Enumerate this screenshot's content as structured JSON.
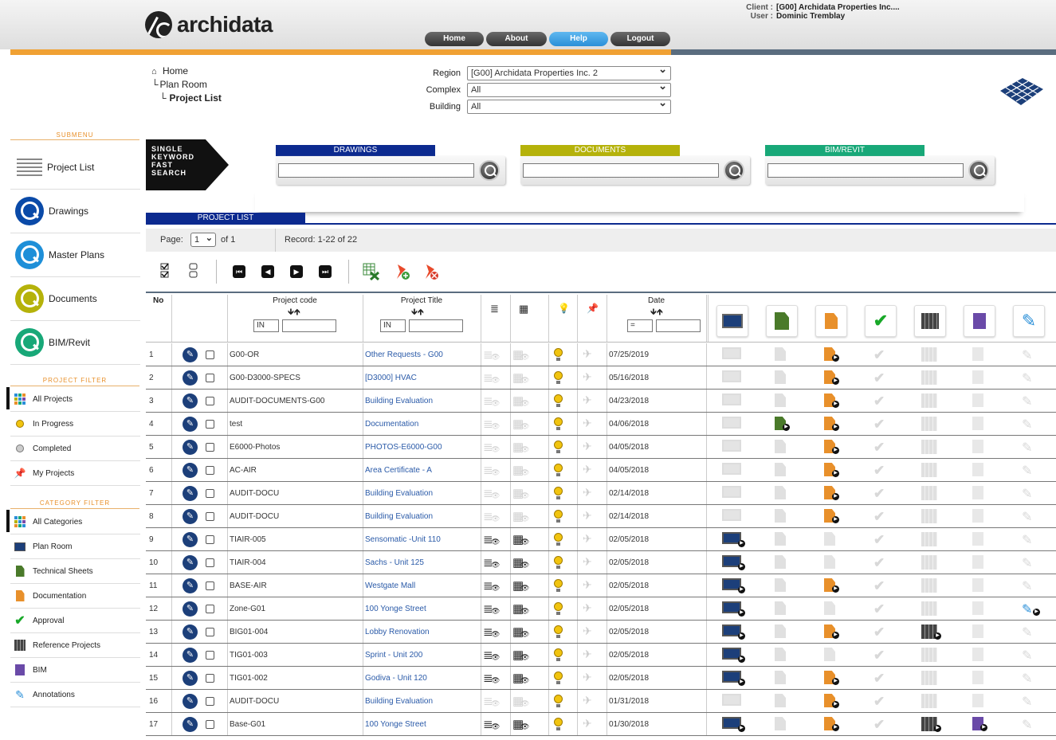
{
  "header": {
    "logo_text": "archidata",
    "client_label": "Client :",
    "client_value": "[G00] Archidata Properties Inc....",
    "user_label": "User :",
    "user_value": "Dominic Tremblay",
    "nav": [
      "Home",
      "About",
      "Help",
      "Logout"
    ]
  },
  "breadcrumb": [
    "Home",
    "Plan Room",
    "Project List"
  ],
  "filters": {
    "region_label": "Region",
    "region_value": "[G00] Archidata Properties Inc. 2",
    "complex_label": "Complex",
    "complex_value": "All",
    "building_label": "Building",
    "building_value": "All"
  },
  "sidebar": {
    "submenu_title": "SUBMENU",
    "main_items": [
      {
        "label": "Project List",
        "icon": "list-icon"
      },
      {
        "label": "Drawings",
        "icon": "search-blue-icon",
        "color": "#0a4aa8"
      },
      {
        "label": "Master Plans",
        "icon": "search-lightblue-icon",
        "color": "#1e8fd8"
      },
      {
        "label": "Documents",
        "icon": "search-olive-icon",
        "color": "#b5b20a"
      },
      {
        "label": "BIM/Revit",
        "icon": "search-green-icon",
        "color": "#18a878"
      }
    ],
    "project_filter_title": "PROJECT FILTER",
    "project_filters": [
      {
        "label": "All Projects",
        "icon": "grid-icon"
      },
      {
        "label": "In Progress",
        "icon": "bulb-icon"
      },
      {
        "label": "Completed",
        "icon": "bulb-off-icon"
      },
      {
        "label": "My Projects",
        "icon": "pin-icon"
      }
    ],
    "category_filter_title": "CATEGORY FILTER",
    "category_filters": [
      {
        "label": "All Categories",
        "icon": "grid-icon"
      },
      {
        "label": "Plan Room",
        "icon": "screen-icon"
      },
      {
        "label": "Technical Sheets",
        "icon": "sheets-icon"
      },
      {
        "label": "Documentation",
        "icon": "doc-icon"
      },
      {
        "label": "Approval",
        "icon": "check-icon"
      },
      {
        "label": "Reference Projects",
        "icon": "binder-icon"
      },
      {
        "label": "BIM",
        "icon": "bim-icon"
      },
      {
        "label": "Annotations",
        "icon": "pencil-icon"
      }
    ]
  },
  "search": {
    "single_text": [
      "SINGLE",
      "KEYWORD",
      "FAST",
      "SEARCH"
    ],
    "drawings_label": "DRAWINGS",
    "documents_label": "DOCUMENTS",
    "bim_label": "BIM/REVIT",
    "colors": {
      "drawings": "#0c2a8f",
      "documents": "#b5b20a",
      "bim": "#18a878"
    }
  },
  "project_list": {
    "title": "PROJECT LIST",
    "page_label": "Page:",
    "page_value": "1",
    "page_of": "of 1",
    "record_label": "Record: 1-22 of 22"
  },
  "table": {
    "col_no": "No",
    "col_code": "Project code",
    "col_title": "Project Title",
    "col_date": "Date",
    "op_in": "IN",
    "op_eq": "=",
    "rows": [
      {
        "no": "1",
        "code": "G00-OR",
        "title": "Other Requests - G00",
        "date": "07/25/2019",
        "drw": false,
        "master": false,
        "tech": false,
        "doc": true,
        "ref": false,
        "bim": false,
        "ann": false
      },
      {
        "no": "2",
        "code": "G00-D3000-SPECS",
        "title": "[D3000] HVAC",
        "date": "05/16/2018",
        "drw": false,
        "master": false,
        "tech": false,
        "doc": true,
        "ref": false,
        "bim": false,
        "ann": false
      },
      {
        "no": "3",
        "code": "AUDIT-DOCUMENTS-G00",
        "title": "Building Evaluation",
        "date": "04/23/2018",
        "drw": false,
        "master": false,
        "tech": false,
        "doc": true,
        "ref": false,
        "bim": false,
        "ann": false
      },
      {
        "no": "4",
        "code": "test",
        "title": "Documentation",
        "date": "04/06/2018",
        "drw": false,
        "master": false,
        "tech": true,
        "doc": true,
        "ref": false,
        "bim": false,
        "ann": false
      },
      {
        "no": "5",
        "code": "E6000-Photos",
        "title": "PHOTOS-E6000-G00",
        "date": "04/05/2018",
        "drw": false,
        "master": false,
        "tech": false,
        "doc": true,
        "ref": false,
        "bim": false,
        "ann": false
      },
      {
        "no": "6",
        "code": "AC-AIR",
        "title": "Area Certificate - A",
        "date": "04/05/2018",
        "drw": false,
        "master": false,
        "tech": false,
        "doc": true,
        "ref": false,
        "bim": false,
        "ann": false
      },
      {
        "no": "7",
        "code": "AUDIT-DOCU",
        "title": "Building Evaluation",
        "date": "02/14/2018",
        "drw": false,
        "master": false,
        "tech": false,
        "doc": true,
        "ref": false,
        "bim": false,
        "ann": false
      },
      {
        "no": "8",
        "code": "AUDIT-DOCU",
        "title": "Building Evaluation",
        "date": "02/14/2018",
        "drw": false,
        "master": false,
        "tech": false,
        "doc": true,
        "ref": false,
        "bim": false,
        "ann": false
      },
      {
        "no": "9",
        "code": "TIAIR-005",
        "title": "Sensomatic -Unit 110",
        "date": "02/05/2018",
        "drw": true,
        "master": true,
        "tech": false,
        "doc": false,
        "ref": false,
        "bim": false,
        "ann": false
      },
      {
        "no": "10",
        "code": "TIAIR-004",
        "title": "Sachs - Unit 125",
        "date": "02/05/2018",
        "drw": true,
        "master": true,
        "tech": false,
        "doc": false,
        "ref": false,
        "bim": false,
        "ann": false
      },
      {
        "no": "11",
        "code": "BASE-AIR",
        "title": "Westgate Mall",
        "date": "02/05/2018",
        "drw": true,
        "master": true,
        "tech": false,
        "doc": true,
        "ref": false,
        "bim": false,
        "ann": false
      },
      {
        "no": "12",
        "code": "Zone-G01",
        "title": "100 Yonge Street",
        "date": "02/05/2018",
        "drw": true,
        "master": true,
        "tech": false,
        "doc": false,
        "ref": false,
        "bim": false,
        "ann": true
      },
      {
        "no": "13",
        "code": "BIG01-004",
        "title": "Lobby Renovation",
        "date": "02/05/2018",
        "drw": true,
        "master": true,
        "tech": false,
        "doc": true,
        "ref": true,
        "bim": false,
        "ann": false
      },
      {
        "no": "14",
        "code": "TIG01-003",
        "title": "Sprint - Unit 200",
        "date": "02/05/2018",
        "drw": true,
        "master": true,
        "tech": false,
        "doc": false,
        "ref": false,
        "bim": false,
        "ann": false
      },
      {
        "no": "15",
        "code": "TIG01-002",
        "title": "Godiva - Unit 120",
        "date": "02/05/2018",
        "drw": true,
        "master": true,
        "tech": false,
        "doc": true,
        "ref": false,
        "bim": false,
        "ann": false
      },
      {
        "no": "16",
        "code": "AUDIT-DOCU",
        "title": "Building Evaluation",
        "date": "01/31/2018",
        "drw": false,
        "master": false,
        "tech": false,
        "doc": true,
        "ref": false,
        "bim": false,
        "ann": false
      },
      {
        "no": "17",
        "code": "Base-G01",
        "title": "100 Yonge Street",
        "date": "01/30/2018",
        "drw": true,
        "master": true,
        "tech": false,
        "doc": true,
        "ref": true,
        "bim": true,
        "ann": false
      }
    ]
  }
}
